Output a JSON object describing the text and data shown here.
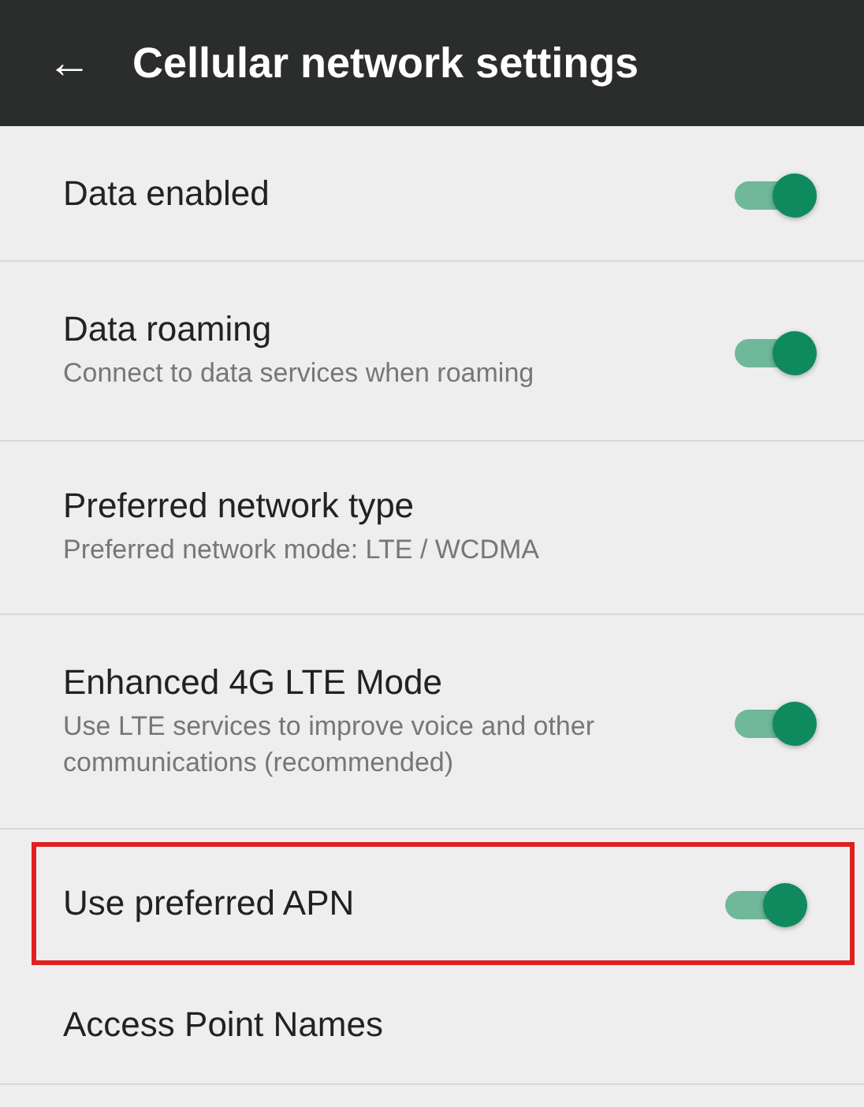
{
  "header": {
    "back_icon": "←",
    "title": "Cellular network settings"
  },
  "items": [
    {
      "kind": "toggle",
      "title": "Data enabled",
      "on": true,
      "highlighted": false
    },
    {
      "kind": "toggle",
      "title": "Data roaming",
      "subtitle": "Connect to data services when roaming",
      "on": true,
      "highlighted": false
    },
    {
      "kind": "plain",
      "title": "Preferred network type",
      "subtitle": "Preferred network mode: LTE / WCDMA",
      "highlighted": false
    },
    {
      "kind": "toggle",
      "title": "Enhanced 4G LTE Mode",
      "subtitle": "Use LTE services to improve voice and other communications (recommended)",
      "on": true,
      "highlighted": false
    },
    {
      "kind": "toggle",
      "title": "Use preferred APN",
      "on": true,
      "highlighted": true
    },
    {
      "kind": "plain",
      "title": "Access Point Names",
      "highlighted": false
    }
  ]
}
